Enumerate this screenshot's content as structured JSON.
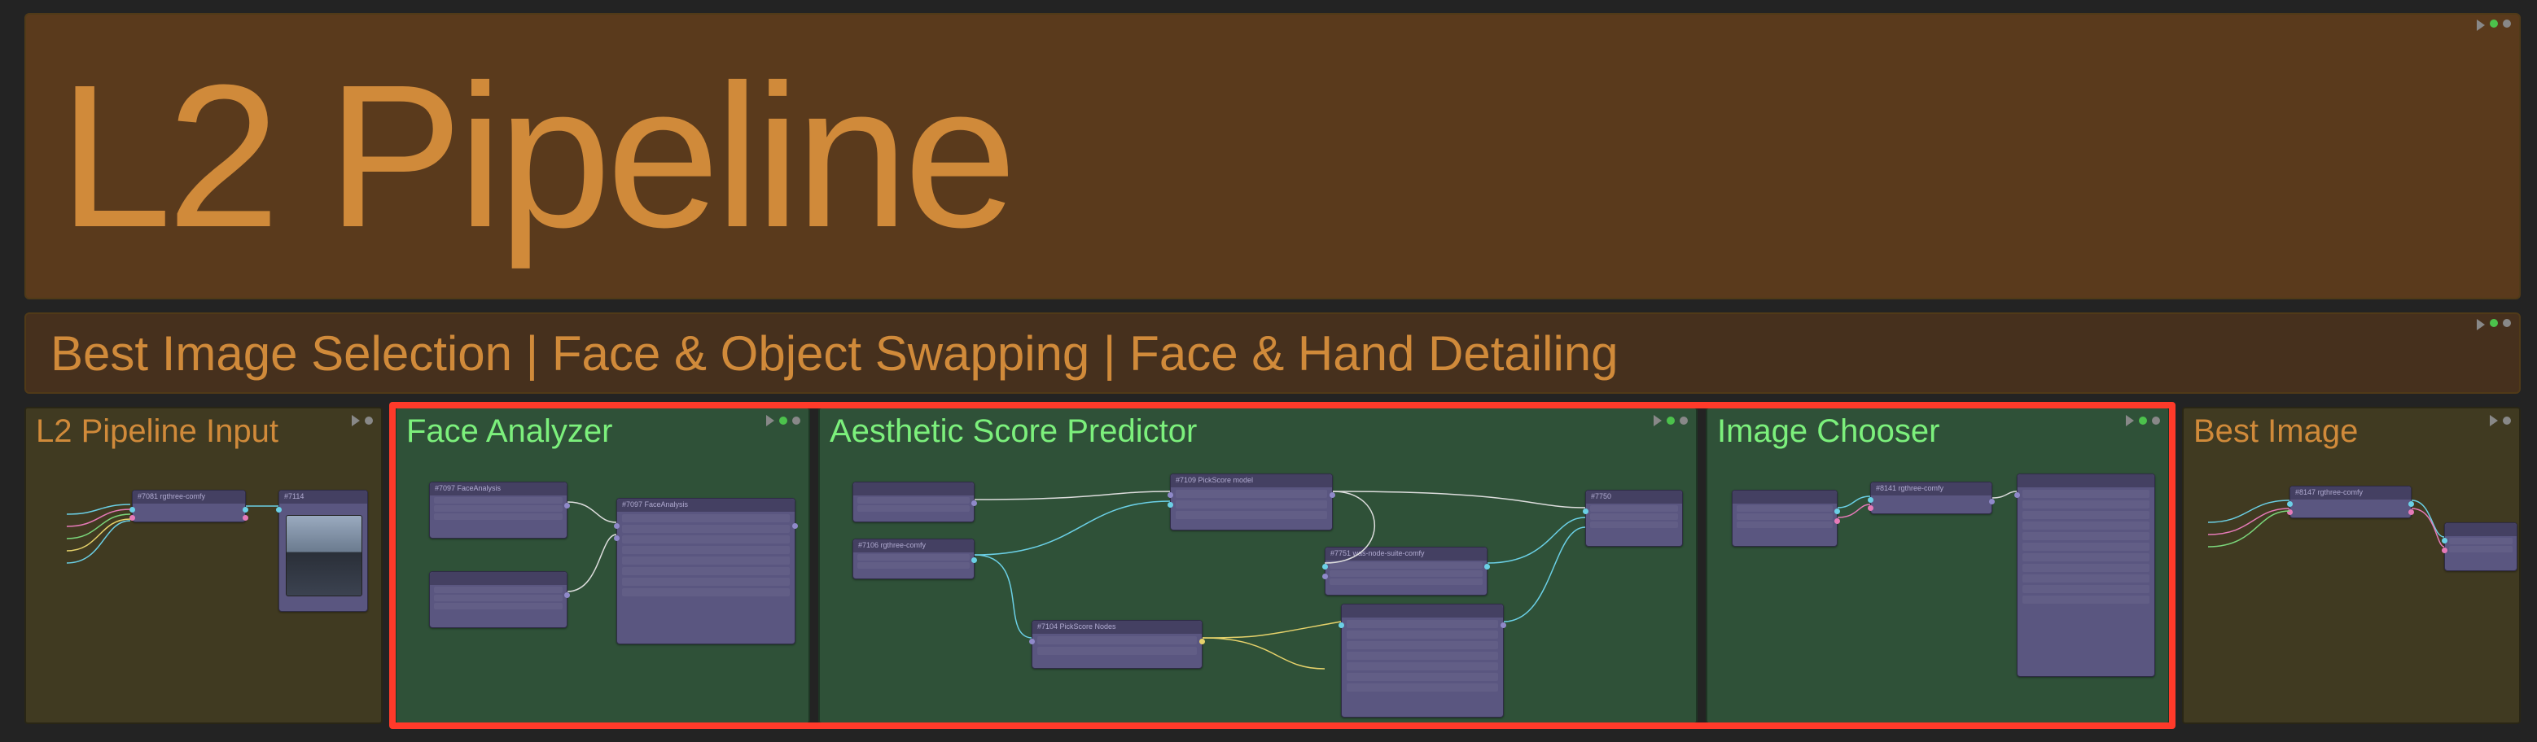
{
  "banner": {
    "title": "L2 Pipeline",
    "subtitle": "Best Image Selection | Face & Object Swapping | Face & Hand Detailing"
  },
  "groups": {
    "input": {
      "title": "L2 Pipeline Input"
    },
    "face": {
      "title": "Face Analyzer"
    },
    "aes": {
      "title": "Aesthetic Score Predictor"
    },
    "chooser": {
      "title": "Image Chooser"
    },
    "best": {
      "title": "Best Image"
    }
  },
  "nodes": {
    "input_hub": {
      "label": "#7081 rgthree-comfy"
    },
    "input_pre": {
      "label": "#7114"
    },
    "face_a": {
      "label": "#7097 FaceAnalysis"
    },
    "face_b": {
      "label": "#7097 FaceAnalysis"
    },
    "aes_l1": {
      "label": ""
    },
    "aes_l2": {
      "label": "#7106 rgthree-comfy"
    },
    "aes_mid": {
      "label": "#7104 PickScore Nodes"
    },
    "aes_top": {
      "label": "#7109 PickScore model"
    },
    "aes_math": {
      "label": "#7751 was-node-suite-comfy"
    },
    "aes_big": {
      "label": ""
    },
    "aes_out": {
      "label": "#7750"
    },
    "chooser_l": {
      "label": ""
    },
    "chooser_mid": {
      "label": "#8141 rgthree-comfy"
    },
    "chooser_big": {
      "label": ""
    },
    "best_hub": {
      "label": "#8147 rgthree-comfy"
    },
    "best_out": {
      "label": ""
    }
  },
  "colors": {
    "wire_cyan": "#6bd0e6",
    "wire_white": "#dddddd",
    "wire_pink": "#e67ab8",
    "wire_green": "#7bd67b",
    "wire_yellow": "#e6d26b"
  }
}
